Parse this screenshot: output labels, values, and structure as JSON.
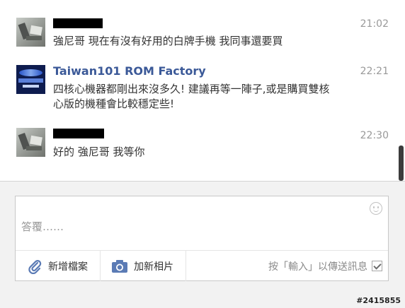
{
  "messages": [
    {
      "sender": "",
      "sender_redacted": true,
      "time": "21:02",
      "text": "強尼哥 現在有沒有好用的白牌手機 我同事還要買"
    },
    {
      "sender": "Taiwan101 ROM Factory",
      "sender_redacted": false,
      "time": "22:21",
      "text": "四核心機器都剛出來沒多久! 建議再等一陣子,或是購買雙核心版的機種會比較穩定些!"
    },
    {
      "sender": "",
      "sender_redacted": true,
      "time": "22:30",
      "text": "好的 強尼哥 我等你"
    }
  ],
  "composer": {
    "placeholder": "答覆……",
    "value": "",
    "emoji_icon": "smiley-icon",
    "attach_label": "新增檔案",
    "attach_icon": "paperclip-icon",
    "photo_label": "加新相片",
    "photo_icon": "camera-icon",
    "enter_to_send_label": "按「輸入」以傳送訊息",
    "enter_to_send_checked": true
  },
  "watermark": "#2415855",
  "colors": {
    "sender_name": "#3b5998",
    "timestamp": "#999999",
    "composer_bg": "#f2f2f2",
    "icon_blue": "#5b7bb5"
  }
}
